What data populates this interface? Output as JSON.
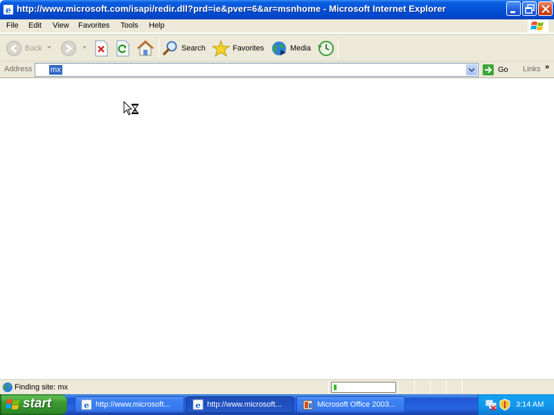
{
  "window": {
    "title": "http://www.microsoft.com/isapi/redir.dll?prd=ie&pver=6&ar=msnhome - Microsoft Internet Explorer"
  },
  "menu": {
    "items": [
      "File",
      "Edit",
      "View",
      "Favorites",
      "Tools",
      "Help"
    ]
  },
  "toolbar": {
    "back_label": "Back",
    "search_label": "Search",
    "favorites_label": "Favorites",
    "media_label": "Media"
  },
  "address": {
    "label": "Address",
    "value": "mx",
    "go_label": "Go",
    "links_label": "Links",
    "links_chevron": "»"
  },
  "status": {
    "text": "Finding site: mx",
    "progress": 0.05
  },
  "taskbar": {
    "start_label": "start",
    "tasks": [
      {
        "label": "http://www.microsoft...",
        "icon": "ie-icon"
      },
      {
        "label": "http://www.microsoft...",
        "icon": "ie-icon"
      },
      {
        "label": "Microsoft Office 2003...",
        "icon": "office-setup-icon"
      }
    ],
    "clock": "3:14 AM"
  },
  "colors": {
    "titlebar": "#0550d8",
    "chrome": "#ece9d8",
    "taskbar": "#2663e0",
    "start": "#3d9a33",
    "selection": "#316ac5"
  }
}
